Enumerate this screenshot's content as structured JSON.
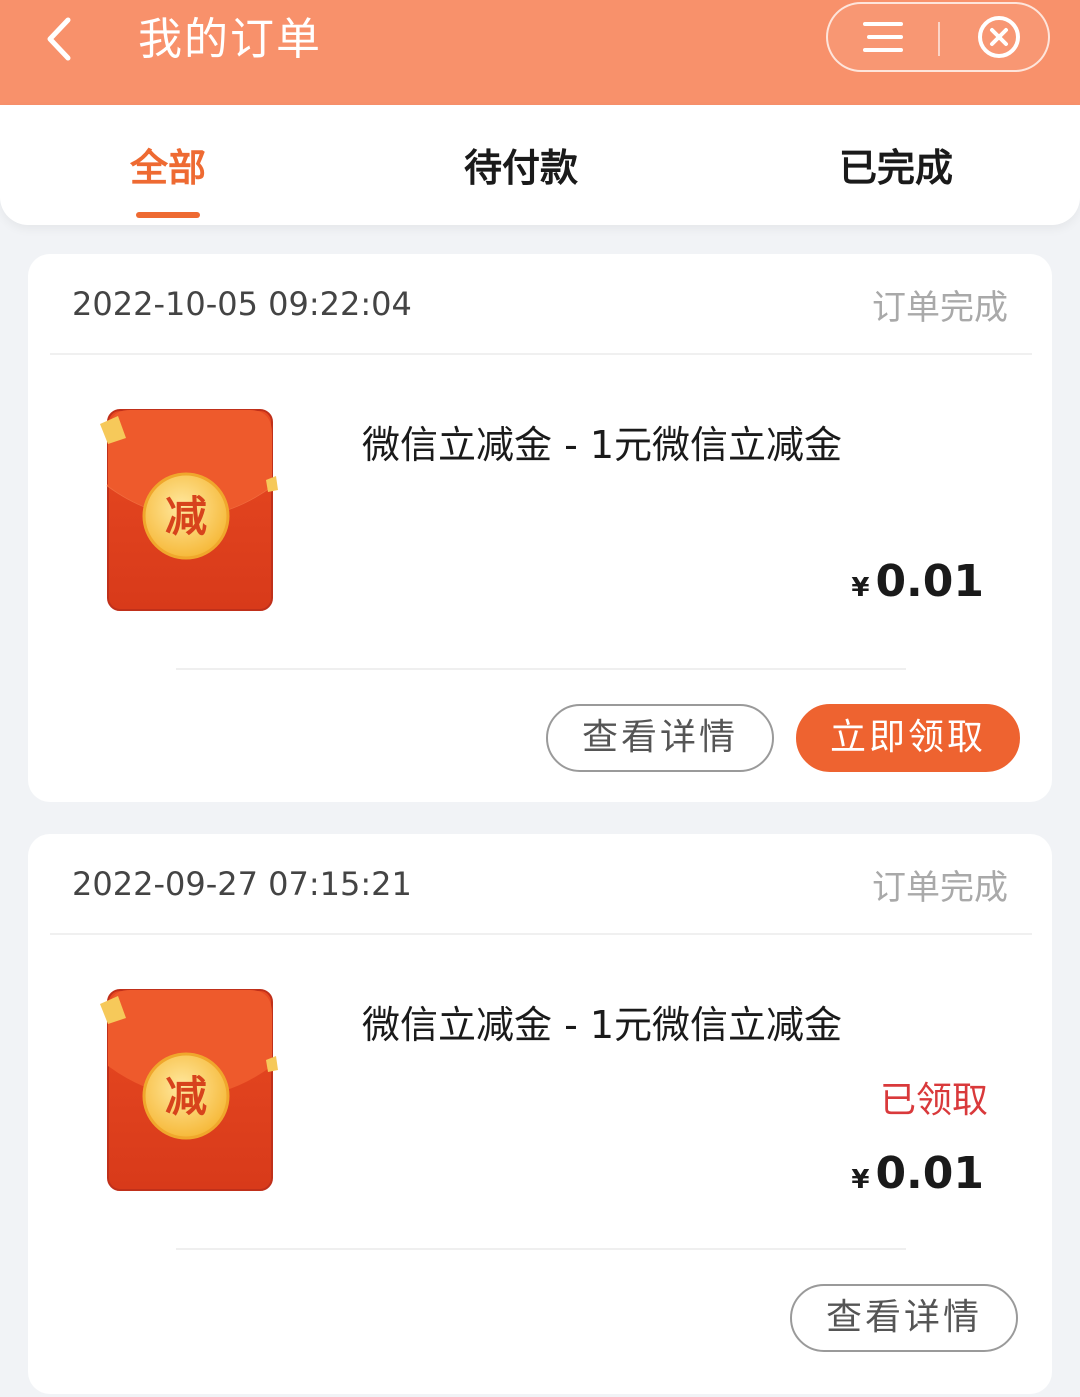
{
  "header": {
    "title": "我的订单",
    "back_icon": "chevron-left-icon",
    "menu_icon": "menu-icon",
    "close_icon": "close-circle-icon",
    "background_color": "#f8916b"
  },
  "tabs": [
    {
      "label": "全部",
      "active": true
    },
    {
      "label": "待付款",
      "active": false
    },
    {
      "label": "已完成",
      "active": false
    }
  ],
  "accent_color": "#ee6a32",
  "orders": [
    {
      "time": "2022-10-05 09:22:04",
      "status": "订单完成",
      "product_name": "微信立减金 - 1元微信立减金",
      "thumbnail_label": "减",
      "claim_status": "",
      "currency": "¥",
      "price": "0.01",
      "detail_button": "查看详情",
      "claim_button": "立即领取"
    },
    {
      "time": "2022-09-27 07:15:21",
      "status": "订单完成",
      "product_name": "微信立减金 - 1元微信立减金",
      "thumbnail_label": "减",
      "claim_status": "已领取",
      "currency": "¥",
      "price": "0.01",
      "detail_button": "查看详情"
    }
  ]
}
